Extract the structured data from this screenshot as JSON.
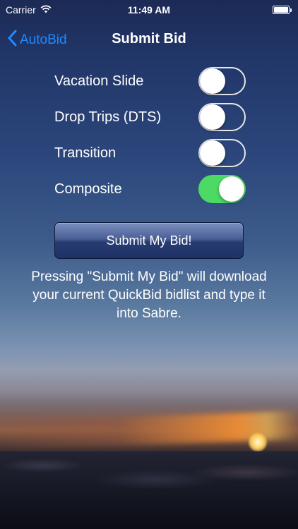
{
  "status_bar": {
    "carrier": "Carrier",
    "time": "11:49 AM"
  },
  "nav": {
    "back_label": "AutoBid",
    "title": "Submit Bid"
  },
  "toggles": [
    {
      "label": "Vacation Slide",
      "on": false
    },
    {
      "label": "Drop Trips (DTS)",
      "on": false
    },
    {
      "label": "Transition",
      "on": false
    },
    {
      "label": "Composite",
      "on": true
    }
  ],
  "submit_button": {
    "label": "Submit My Bid!"
  },
  "info_text": "Pressing \"Submit My Bid\" will download your current QuickBid bidlist and type it into Sabre.",
  "colors": {
    "accent_blue": "#1f8bff",
    "switch_on_green": "#4cd964"
  },
  "icons": [
    "wifi-icon",
    "battery-icon",
    "chevron-left-icon"
  ]
}
